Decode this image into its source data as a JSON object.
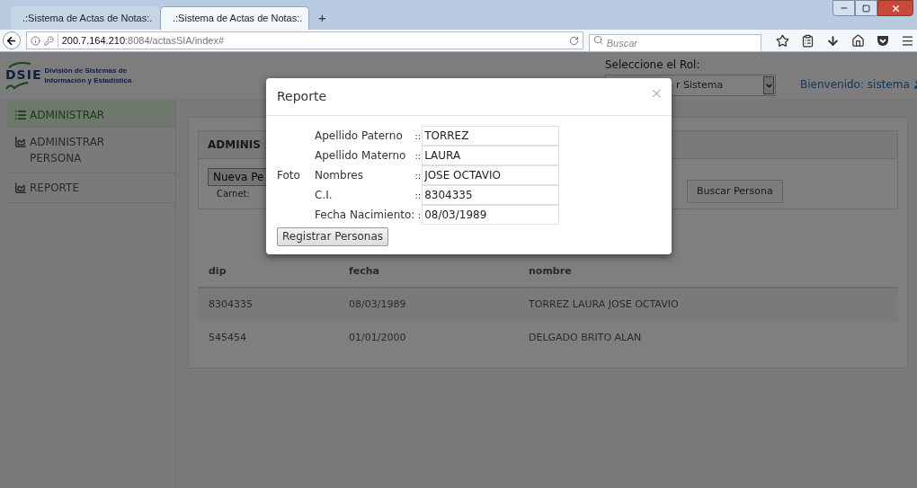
{
  "browser": {
    "tabs": [
      {
        "title": ".:Sistema de Actas de Notas:.",
        "selected": false
      },
      {
        "title": ".:Sistema de Actas de Notas:.",
        "selected": true
      }
    ],
    "new_tab": "+",
    "url_host": "200.7.164.210",
    "url_rest": ":8084/actasSIA/index#",
    "search_placeholder": "Buscar"
  },
  "header": {
    "logo_mark": "DSIE",
    "logo_line1": "División de Sistemas de",
    "logo_line2": "Información y Estadística",
    "role_label": "Seleccione el Rol:",
    "role_value": "r Sistema",
    "welcome": "Bienvenido: sistema"
  },
  "sidebar": {
    "items": [
      {
        "label": "ADMINISTRAR",
        "kind": "list",
        "selected": true
      },
      {
        "label": "ADMINISTRAR PERSONA",
        "kind": "chart",
        "selected": false
      },
      {
        "label": "REPORTE",
        "kind": "chart",
        "selected": false
      }
    ]
  },
  "panel": {
    "title": "ADMINIS",
    "new_button": "Nueva Pe",
    "carnet_label": "Carnet:",
    "search_button": "Buscar Persona"
  },
  "table": {
    "columns": [
      "dip",
      "fecha",
      "nombre"
    ],
    "rows": [
      [
        "8304335",
        "08/03/1989",
        "TORREZ LAURA JOSE OCTAVIO"
      ],
      [
        "545454",
        "01/01/2000",
        "DELGADO BRITO ALAN"
      ]
    ]
  },
  "modal": {
    "title": "Reporte",
    "close": "×",
    "photo_label": "Foto",
    "fields": [
      {
        "label": "Apellido Paterno",
        "separator": "::",
        "value": "TORREZ"
      },
      {
        "label": "Apellido Materno",
        "separator": "::",
        "value": "LAURA"
      },
      {
        "label": "Nombres",
        "separator": "::",
        "value": "JOSE OCTAVIO"
      },
      {
        "label": "C.I.",
        "separator": "::",
        "value": "8304335"
      },
      {
        "label": "Fecha Nacimiento:",
        "separator": ":",
        "value": "08/03/1989"
      }
    ],
    "submit": "Registrar Personas"
  }
}
